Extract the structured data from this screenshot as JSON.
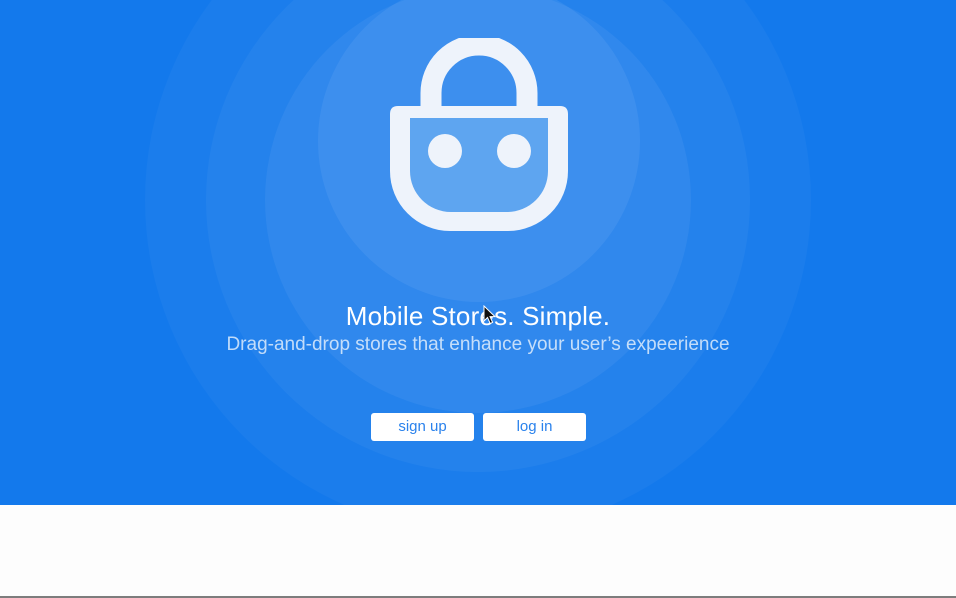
{
  "hero": {
    "background_color": "#1379ec",
    "icon": "shopping-bag-robot-icon",
    "headline": "Mobile Stores. Simple.",
    "subline": "Drag-and-drop stores that enhance your user’s expeerience"
  },
  "actions": {
    "signup_label": "sign up",
    "login_label": "log in",
    "button_text_color": "#2a82ec"
  },
  "cursor": {
    "icon": "mouse-pointer-icon"
  }
}
